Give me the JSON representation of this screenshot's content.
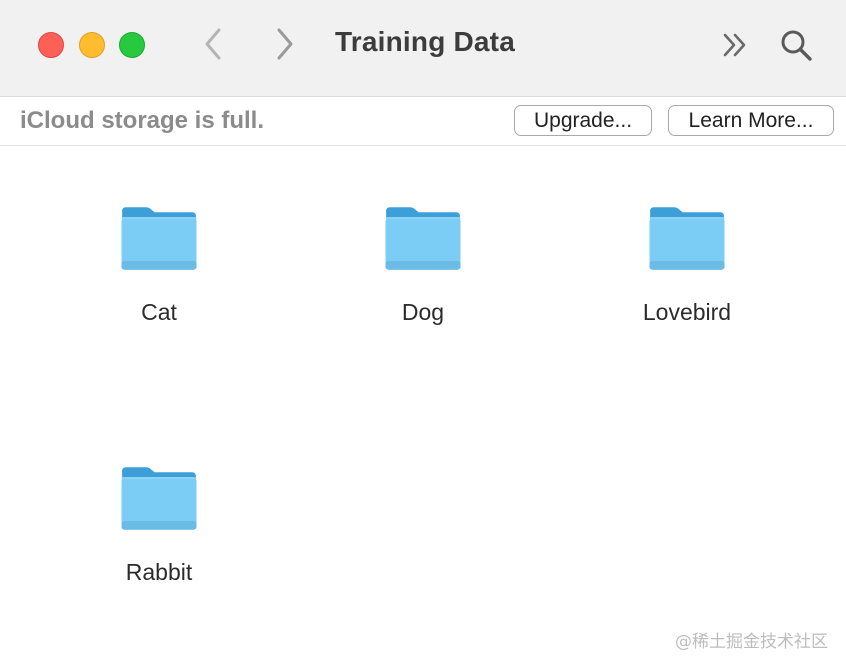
{
  "window": {
    "title": "Training Data"
  },
  "toolbar": {
    "back_icon": "chevron-left-icon",
    "forward_icon": "chevron-right-icon",
    "more_icon": "double-chevron-right-icon",
    "search_icon": "search-icon"
  },
  "banner": {
    "message": "iCloud storage is full.",
    "upgrade_label": "Upgrade...",
    "learn_more_label": "Learn More..."
  },
  "folders": [
    {
      "name": "Cat"
    },
    {
      "name": "Dog"
    },
    {
      "name": "Lovebird"
    },
    {
      "name": "Rabbit"
    }
  ],
  "watermark": "@稀土掘金技术社区",
  "colors": {
    "close": "#fe5f57",
    "minimize": "#febc2e",
    "zoom": "#28c840",
    "folder_body": "#7ccdf6",
    "folder_back": "#3d9fd8"
  }
}
